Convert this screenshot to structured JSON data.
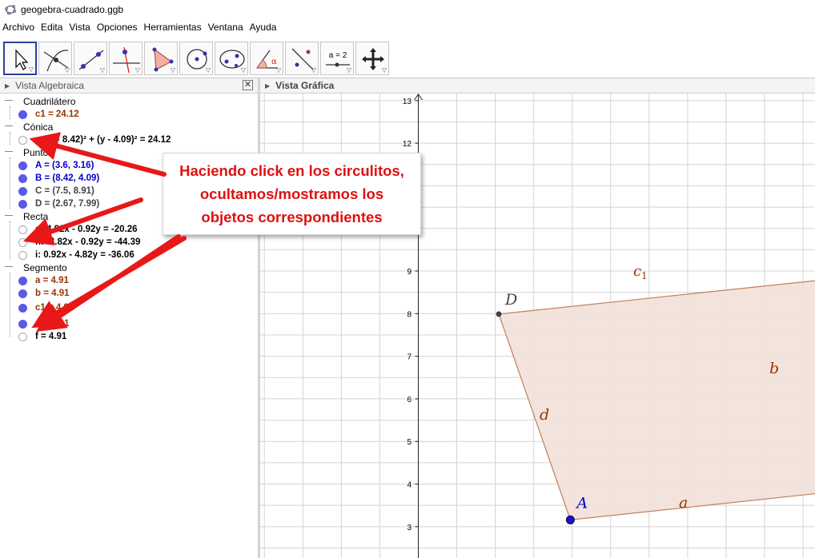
{
  "window": {
    "title": "geogebra-cuadrado.ggb"
  },
  "menu": [
    "Archivo",
    "Edita",
    "Vista",
    "Opciones",
    "Herramientas",
    "Ventana",
    "Ayuda"
  ],
  "toolbar": {
    "tools": [
      "move-tool",
      "point-tool",
      "line-tool",
      "perpendicular-tool",
      "polygon-tool",
      "circle-tool",
      "conic-tool",
      "angle-tool",
      "reflect-tool",
      "slider-tool",
      "move-view-tool"
    ],
    "slider_label": "a = 2",
    "angle_label": "α"
  },
  "algebra_view": {
    "title": "Vista Algebraica",
    "categories": [
      {
        "name": "Cuadrilátero",
        "items": [
          {
            "text": "c1 = 24.12",
            "visible": true,
            "color": "#993300"
          }
        ]
      },
      {
        "name": "Cónica",
        "items": [
          {
            "text": "c: (x - 8.42)² + (y - 4.09)² = 24.12",
            "visible": false,
            "color": "#000000"
          }
        ]
      },
      {
        "name": "Punto",
        "items": [
          {
            "text": "A = (3.6, 3.16)",
            "visible": true,
            "color": "#0000cc"
          },
          {
            "text": "B = (8.42, 4.09)",
            "visible": true,
            "color": "#0000cc"
          },
          {
            "text": "C = (7.5, 8.91)",
            "visible": true,
            "color": "#444444"
          },
          {
            "text": "D = (2.67, 7.99)",
            "visible": true,
            "color": "#444444"
          }
        ]
      },
      {
        "name": "Recta",
        "items": [
          {
            "text": "g: 4.82x - 0.92y = -20.26",
            "visible": false,
            "color": "#000000"
          },
          {
            "text": "h: -4.82x - 0.92y = -44.39",
            "visible": false,
            "color": "#000000"
          },
          {
            "text": "i: 0.92x - 4.82y = -36.06",
            "visible": false,
            "color": "#000000"
          }
        ]
      },
      {
        "name": "Segmento",
        "items": [
          {
            "text": "a = 4.91",
            "visible": true,
            "color": "#993300"
          },
          {
            "text": "b = 4.91",
            "visible": true,
            "color": "#993300"
          },
          {
            "text": "c1 = 4.91",
            "visible": true,
            "color": "#993300"
          },
          {
            "text": "d = 4.91",
            "visible": true,
            "color": "#993300"
          },
          {
            "text": "f = 4.91",
            "visible": false,
            "color": "#000000"
          }
        ]
      }
    ]
  },
  "graphics_view": {
    "title": "Vista Gráfica",
    "y_ticks": [
      "3",
      "4",
      "5",
      "6",
      "7",
      "8",
      "9",
      "12",
      "13"
    ],
    "points": [
      {
        "name": "A",
        "x": 3.6,
        "y": 3.16,
        "color": "#0000cc"
      },
      {
        "name": "B",
        "x": 8.42,
        "y": 4.09,
        "color": "#0000cc"
      },
      {
        "name": "C",
        "x": 7.5,
        "y": 8.91,
        "color": "#444444"
      },
      {
        "name": "D",
        "x": 2.67,
        "y": 7.99,
        "color": "#444444"
      }
    ],
    "segment_labels": {
      "a": "a",
      "b": "b",
      "c1": "c",
      "c1_sub": "1",
      "d": "d"
    },
    "polygon_fill": "#f1e2da",
    "segment_color": "#c0805a"
  },
  "callout": {
    "lines": [
      "Haciendo click en los circulitos,",
      "ocultamos/mostramos los",
      "objetos correspondientes"
    ],
    "color": "#e01010"
  }
}
